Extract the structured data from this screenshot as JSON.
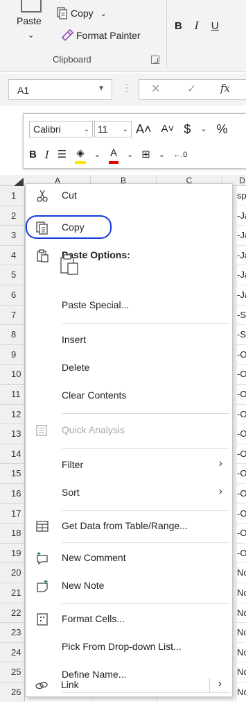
{
  "ribbon": {
    "paste_label": "Paste",
    "copy_label": "Copy",
    "format_painter_label": "Format Painter",
    "group_label": "Clipboard",
    "bold": "B",
    "italic": "I",
    "underline": "U"
  },
  "formula_bar": {
    "name_box": "A1",
    "fx": "fx"
  },
  "columns": [
    "A",
    "B",
    "C",
    "D"
  ],
  "rows": [
    "1",
    "2",
    "3",
    "4",
    "5",
    "6",
    "7",
    "8",
    "9",
    "10",
    "11",
    "12",
    "13",
    "14",
    "15",
    "16",
    "17",
    "18",
    "19",
    "20",
    "21",
    "22",
    "23",
    "24",
    "25",
    "26"
  ],
  "column_d": [
    "sp",
    "-Ja",
    "-Ja",
    "-Ja",
    "-Ja",
    "-Ja",
    "-Se",
    "-Se",
    "-O",
    "-O",
    "-O",
    "-O",
    "-O",
    "-O",
    "-O",
    "-O",
    "-O",
    "-O",
    "-O",
    "No",
    "No",
    "No",
    "No",
    "No",
    "No",
    "No"
  ],
  "mini_toolbar": {
    "font": "Calibri",
    "size": "11",
    "grow": "A˄",
    "shrink": "A˅",
    "currency": "$",
    "percent": "%",
    "bold": "B",
    "italic": "I"
  },
  "menu": {
    "cut": "Cut",
    "copy": "Copy",
    "paste_options": "Paste Options:",
    "paste_special": "Paste Special...",
    "insert": "Insert",
    "delete": "Delete",
    "clear_contents": "Clear Contents",
    "quick_analysis": "Quick Analysis",
    "filter": "Filter",
    "sort": "Sort",
    "get_data": "Get Data from Table/Range...",
    "new_comment": "New Comment",
    "new_note": "New Note",
    "format_cells": "Format Cells...",
    "pick_list": "Pick From Drop-down List...",
    "define_name": "Define Name...",
    "link": "Link"
  },
  "colors": {
    "highlight": "#1238d6",
    "fill_color": "#ffe600",
    "font_color": "#e60000"
  }
}
